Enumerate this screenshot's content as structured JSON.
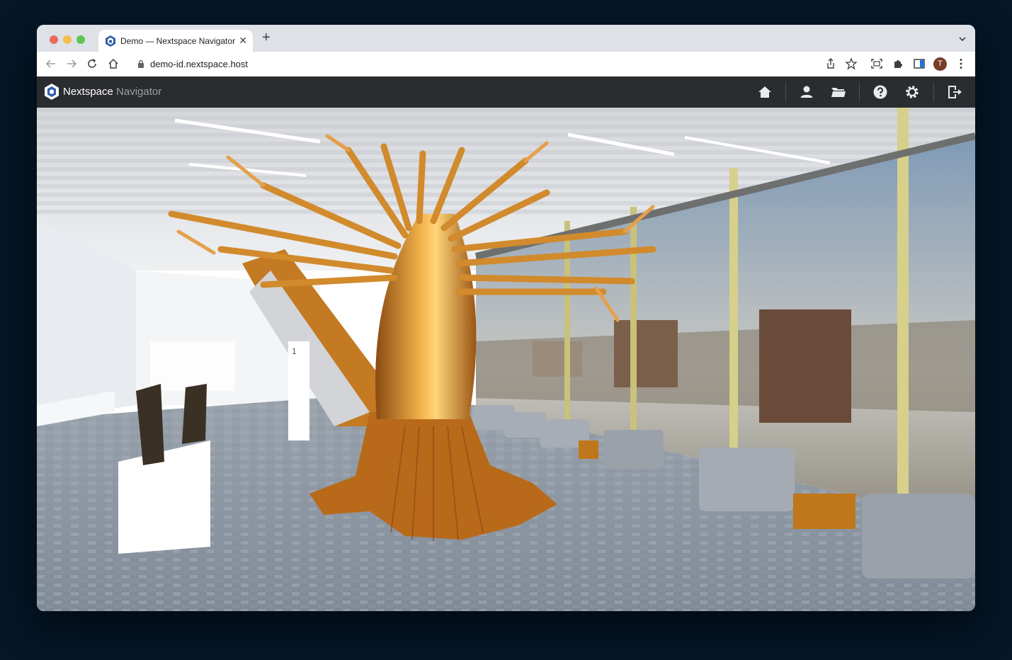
{
  "browser": {
    "tab": {
      "title": "Demo — Nextspace Navigator",
      "close_glyph": "✕"
    },
    "new_tab_glyph": "+",
    "address": {
      "url": "demo-id.nextspace.host"
    },
    "profile_initial": "T"
  },
  "app": {
    "brand": "Nextspace",
    "product": "Navigator",
    "actions": [
      {
        "name": "home-icon"
      },
      {
        "name": "user-icon"
      },
      {
        "name": "folder-icon"
      },
      {
        "name": "help-icon"
      },
      {
        "name": "settings-icon"
      },
      {
        "name": "logout-icon"
      }
    ]
  },
  "viewport": {
    "scene": "3d-scene",
    "floor_marker": "1"
  },
  "colors": {
    "page_bg": "#041627",
    "tabstrip": "#dee1e6",
    "appbar": "#2a2c2f",
    "accent_wood": "#c8801e"
  }
}
